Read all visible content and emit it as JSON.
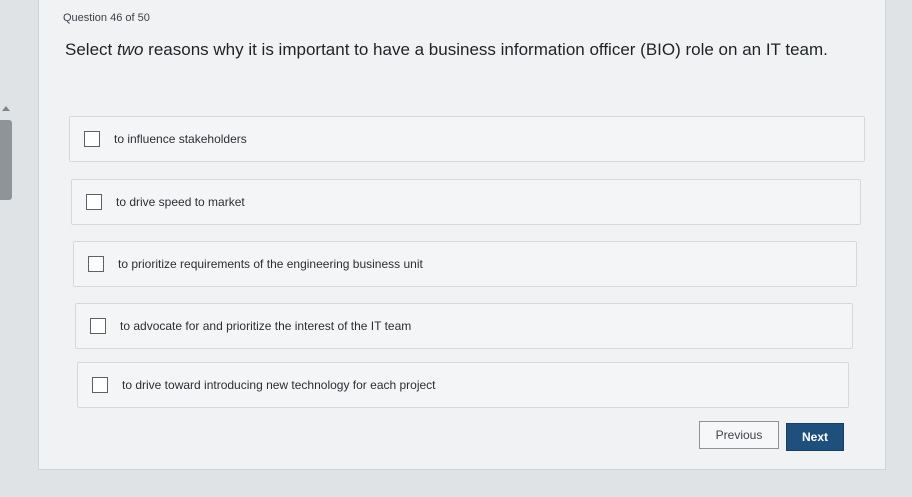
{
  "quiz": {
    "counter": "Question 46 of 50",
    "prompt_before_emphasis": "Select ",
    "prompt_emphasis": "two",
    "prompt_after_emphasis": " reasons why it is important to have a business information officer (BIO) role on an IT team.",
    "options": [
      {
        "label": "to influence stakeholders",
        "checked": false
      },
      {
        "label": "to drive speed to market",
        "checked": false
      },
      {
        "label": "to prioritize requirements of the engineering business unit",
        "checked": false
      },
      {
        "label": "to advocate for and prioritize the interest of the IT team",
        "checked": false
      },
      {
        "label": "to drive toward introducing new technology for each project",
        "checked": false
      }
    ]
  },
  "nav": {
    "previous_label": "Previous",
    "next_label": "Next"
  },
  "colors": {
    "background": "#dfe3e6",
    "card": "#f1f2f4",
    "next_button": "#1e4f7d"
  }
}
